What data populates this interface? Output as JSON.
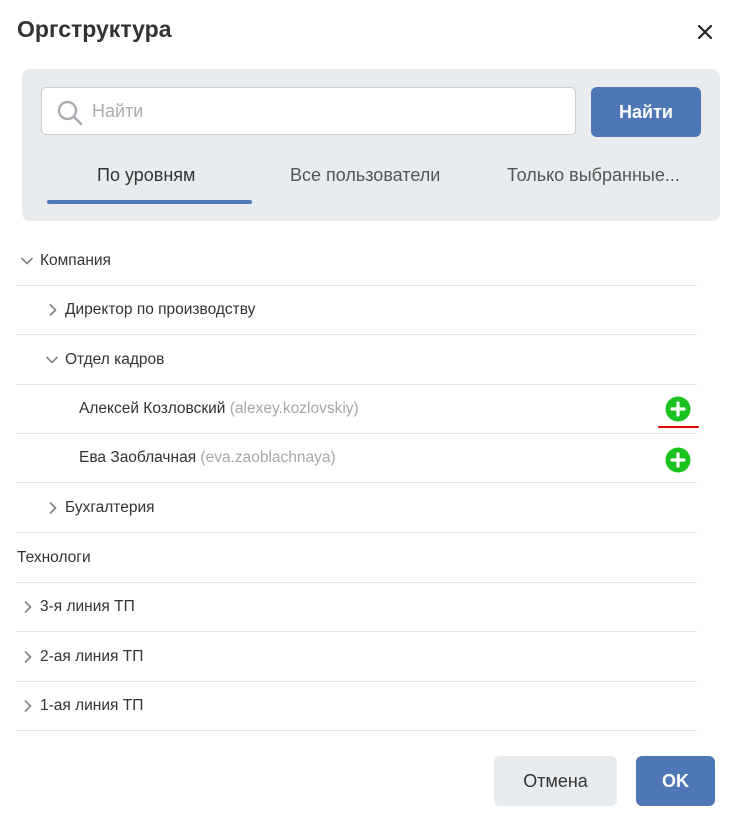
{
  "dialog": {
    "title": "Оргструктура"
  },
  "search": {
    "placeholder": "Найти",
    "value": "",
    "button_label": "Найти"
  },
  "tabs": [
    {
      "label": "По уровням",
      "active": true
    },
    {
      "label": "Все пользователи",
      "active": false
    },
    {
      "label": "Только выбранные..."
    }
  ],
  "tree": [
    {
      "label": "Компания",
      "expanded": true
    },
    {
      "label": "Директор по производству",
      "expanded": false
    },
    {
      "label": "Отдел кадров",
      "expanded": true
    },
    {
      "name": "Алексей Козловский",
      "login": "(alexey.kozlovskiy)"
    },
    {
      "name": "Ева Заоблачная",
      "login": "(eva.zaoblachnaya)"
    },
    {
      "label": "Бухгалтерия",
      "expanded": false
    },
    {
      "label": "Технологи"
    },
    {
      "label": "3-я линия ТП",
      "expanded": false
    },
    {
      "label": "2-ая линия ТП",
      "expanded": false
    },
    {
      "label": "1-ая линия ТП",
      "expanded": false
    }
  ],
  "footer": {
    "cancel_label": "Отмена",
    "ok_label": "OK"
  },
  "colors": {
    "accent": "#4f76b6",
    "add_icon": "#19c21e",
    "annotation": "#e10000",
    "panel_bg": "#e8ecef"
  }
}
